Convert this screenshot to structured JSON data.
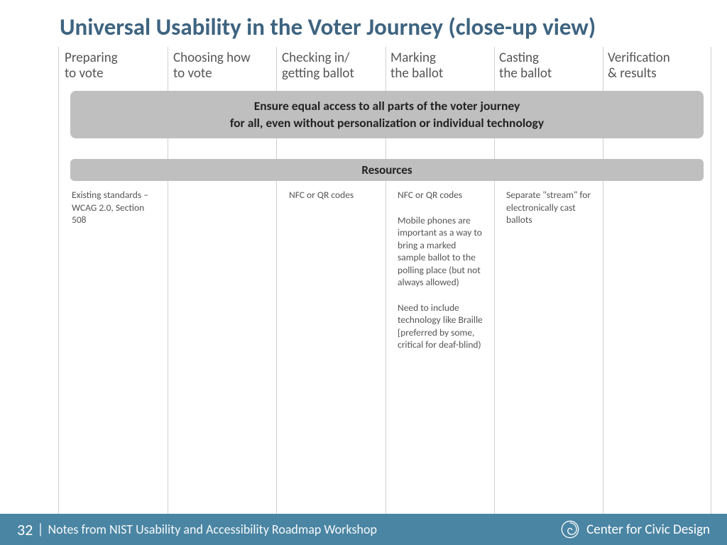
{
  "title": "Universal Usability in the Voter Journey (close-up view)",
  "columns": [
    "Preparing\nto vote",
    "Choosing how\nto vote",
    "Checking in/\ngetting ballot",
    "Marking\nthe ballot",
    "Casting\nthe ballot",
    "Verification\n& results"
  ],
  "banner1_line1": "Ensure equal access to all parts of the voter journey",
  "banner1_line2": "for all, even without personalization or individual technology",
  "banner2": "Resources",
  "cells": {
    "c0": [
      "Existing standards – WCAG 2.0, Section 508"
    ],
    "c1": [],
    "c2": [
      "NFC or QR codes"
    ],
    "c3": [
      "NFC or QR codes",
      "Mobile phones are important as a way to bring a marked sample ballot to the polling place (but not always allowed)",
      "Need to include technology like Braille [preferred by some, critical for deaf-blind)"
    ],
    "c4": [
      "Separate \"stream\" for electronically cast ballots"
    ],
    "c5": []
  },
  "footer": {
    "page": "32",
    "text": "Notes from NIST Usability and Accessibility Roadmap  Workshop",
    "brand": "Center for Civic Design"
  }
}
